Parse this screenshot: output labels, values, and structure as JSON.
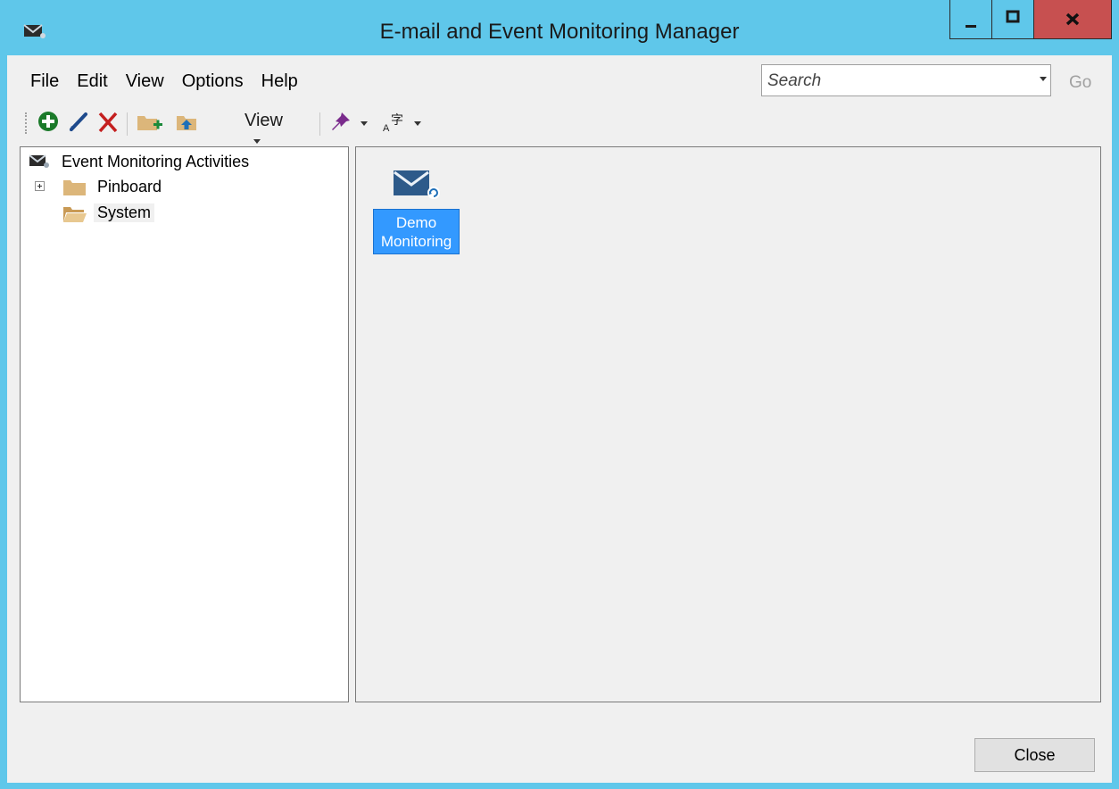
{
  "window": {
    "title": "E-mail and Event Monitoring Manager"
  },
  "menu": {
    "items": [
      "File",
      "Edit",
      "View",
      "Options",
      "Help"
    ]
  },
  "search": {
    "placeholder": "Search",
    "go_label": "Go"
  },
  "toolbar": {
    "view_label": "View"
  },
  "tree": {
    "root_label": "Event Monitoring Activities",
    "items": [
      {
        "label": "Pinboard",
        "expandable": true
      },
      {
        "label": "System",
        "expandable": false
      }
    ]
  },
  "content": {
    "items": [
      {
        "label_line1": "Demo",
        "label_line2": "Monitoring"
      }
    ]
  },
  "footer": {
    "close_label": "Close"
  },
  "colors": {
    "title_bar": "#5fc7ea",
    "selection": "#3399ff",
    "close_button": "#c75050",
    "folder": "#dcb67a"
  },
  "icons": [
    "app-mail-icon",
    "add-icon",
    "edit-icon",
    "delete-icon",
    "new-folder-icon",
    "folder-up-icon",
    "pin-icon",
    "font-icon",
    "folder-icon",
    "folder-open-icon",
    "mail-refresh-icon"
  ]
}
